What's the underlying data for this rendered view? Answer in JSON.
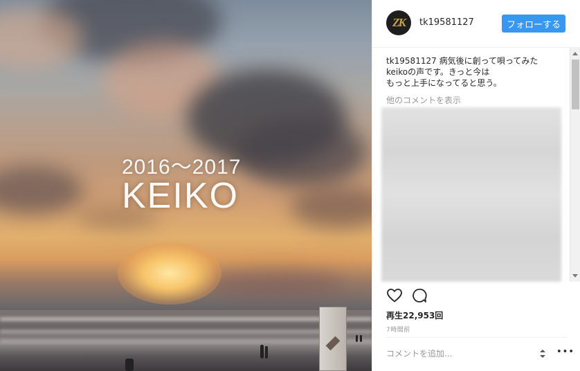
{
  "media": {
    "title_years": "2016〜2017",
    "title_name": "KEIKO"
  },
  "header": {
    "avatar_text": "ZK",
    "username": "tk19581127",
    "follow_label": "フォローする"
  },
  "caption": {
    "user": "tk19581127",
    "text_line1": "病気後に創って唄ってみた",
    "text_line2": "keikoの声です。きっと今は",
    "text_line3": "もっと上手になってると思う。"
  },
  "comments": {
    "load_more": "他のコメントを表示"
  },
  "stats": {
    "plays": "再生22,953回",
    "time_ago": "7時間前"
  },
  "comment_box": {
    "placeholder": "コメントを追加..."
  },
  "icons": {
    "like": "heart-icon",
    "comment": "comment-bubble-icon",
    "more": "more-options-icon"
  },
  "colors": {
    "follow_button": "#3897f0",
    "muted_text": "#999999",
    "divider": "#efefef"
  }
}
